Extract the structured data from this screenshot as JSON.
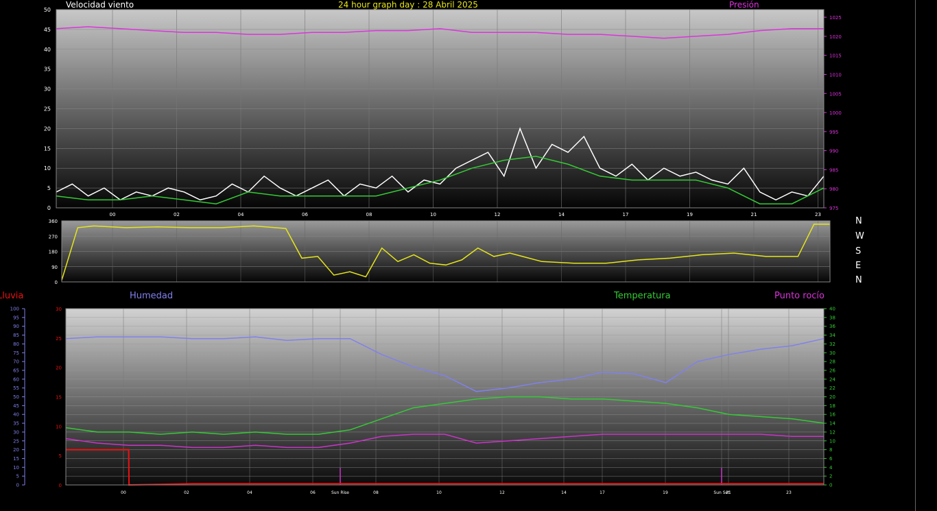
{
  "header": {
    "wind_title": "Velocidad viento",
    "date_title": "24 hour graph day : 28 Abril 2025",
    "pressure_title": "Presión"
  },
  "compass": [
    "N",
    "W",
    "S",
    "E",
    "N"
  ],
  "bottom_titles": {
    "rain": "Lluvia",
    "humidity": "Humedad",
    "temperature": "Temperatura",
    "dewpoint": "Punto rocío"
  },
  "markers": {
    "sunrise": "Sun Rise",
    "sunset": "Sun Set"
  },
  "colors": {
    "wind": "#ffffff",
    "wind_avg": "#33cc33",
    "pressure": "#dd33dd",
    "direction": "#e6e619",
    "humidity": "#8080ee",
    "temperature": "#33cc33",
    "dewpoint": "#cc33cc",
    "rain": "#ee1111",
    "pressure_axis": "#dd33dd",
    "temp_axis": "#33cc33",
    "humidity_axis": "#8080ee",
    "rain_axis": "#ee1111"
  },
  "chart_data": [
    {
      "type": "line",
      "name": "wind",
      "x_ticks": [
        "00",
        "02",
        "04",
        "06",
        "08",
        "10",
        "12",
        "14",
        "17",
        "19",
        "21",
        "23"
      ],
      "y_left_ticks": [
        0,
        5,
        10,
        15,
        20,
        25,
        30,
        35,
        40,
        45,
        50
      ],
      "y_right_ticks": [
        975,
        980,
        985,
        990,
        995,
        1000,
        1005,
        1010,
        1015,
        1020,
        1025
      ],
      "ylim_left": [
        0,
        50
      ],
      "ylim_right": [
        975,
        1027
      ],
      "series": [
        {
          "key": "gust",
          "axis": "left",
          "x": [
            0,
            0.5,
            1,
            1.5,
            2,
            2.5,
            3,
            3.5,
            4,
            4.5,
            5,
            5.5,
            6,
            6.5,
            7,
            7.5,
            8,
            8.5,
            9,
            9.5,
            10,
            10.5,
            11,
            11.5,
            12,
            12.5,
            13,
            13.5,
            14,
            14.5,
            15,
            15.5,
            16,
            16.5,
            17,
            17.5,
            18,
            18.5,
            19,
            19.5,
            20,
            20.5,
            21,
            21.5,
            22,
            22.5,
            23,
            23.5,
            24
          ],
          "values": [
            4,
            6,
            3,
            5,
            2,
            4,
            3,
            5,
            4,
            2,
            3,
            6,
            4,
            8,
            5,
            3,
            5,
            7,
            3,
            6,
            5,
            8,
            4,
            7,
            6,
            10,
            12,
            14,
            8,
            20,
            10,
            16,
            14,
            18,
            10,
            8,
            11,
            7,
            10,
            8,
            9,
            7,
            6,
            10,
            4,
            2,
            4,
            3,
            8
          ]
        },
        {
          "key": "average",
          "axis": "left",
          "x": [
            0,
            1,
            2,
            3,
            4,
            5,
            6,
            7,
            8,
            9,
            10,
            11,
            12,
            13,
            14,
            15,
            16,
            17,
            18,
            19,
            20,
            21,
            22,
            23,
            24
          ],
          "values": [
            3,
            2,
            2,
            3,
            2,
            1,
            4,
            3,
            3,
            3,
            3,
            5,
            7,
            10,
            12,
            13,
            11,
            8,
            7,
            7,
            7,
            5,
            1,
            1,
            5
          ]
        },
        {
          "key": "pressure",
          "axis": "right",
          "x": [
            0,
            1,
            2,
            3,
            4,
            5,
            6,
            7,
            8,
            9,
            10,
            11,
            12,
            13,
            14,
            15,
            16,
            17,
            18,
            19,
            20,
            21,
            22,
            23,
            24
          ],
          "values": [
            1022,
            1022.5,
            1022,
            1021.5,
            1021,
            1021,
            1020.5,
            1020.5,
            1021,
            1021,
            1021.5,
            1021.5,
            1022,
            1021,
            1021,
            1021,
            1020.5,
            1020.5,
            1020,
            1019.5,
            1020,
            1020.5,
            1021.5,
            1022,
            1022
          ]
        }
      ]
    },
    {
      "type": "line",
      "name": "wind-direction",
      "x_ticks": [
        "00",
        "02",
        "04",
        "06",
        "08",
        "10",
        "12",
        "14",
        "17",
        "19",
        "21",
        "23"
      ],
      "y_ticks": [
        0,
        90,
        180,
        270,
        360
      ],
      "ylim": [
        0,
        360
      ],
      "series": [
        {
          "key": "direction",
          "x": [
            0,
            0.5,
            1,
            2,
            3,
            4,
            5,
            6,
            7,
            7.5,
            8,
            8.5,
            9,
            9.5,
            10,
            10.5,
            11,
            11.5,
            12,
            12.5,
            13,
            13.5,
            14,
            15,
            16,
            17,
            18,
            19,
            20,
            21,
            22,
            23,
            23.5,
            24
          ],
          "values": [
            10,
            320,
            330,
            320,
            325,
            320,
            320,
            330,
            315,
            140,
            150,
            40,
            60,
            30,
            200,
            120,
            160,
            110,
            100,
            130,
            200,
            150,
            170,
            120,
            110,
            110,
            130,
            140,
            160,
            170,
            150,
            150,
            340,
            340
          ]
        }
      ]
    },
    {
      "type": "line",
      "name": "humidity-temperature",
      "x_ticks": [
        "00",
        "02",
        "04",
        "06",
        "Sun Rise",
        "08",
        "10",
        "12",
        "14",
        "17",
        "19",
        "Sun Set",
        "21",
        "23"
      ],
      "y_rain_ticks": [
        0,
        5,
        10,
        15,
        20,
        25,
        30
      ],
      "y_humidity_ticks": [
        0,
        5,
        10,
        15,
        20,
        25,
        30,
        35,
        40,
        45,
        50,
        55,
        60,
        65,
        70,
        75,
        80,
        85,
        90,
        95,
        100
      ],
      "y_temp_ticks": [
        0,
        2,
        4,
        6,
        8,
        10,
        12,
        14,
        16,
        18,
        20,
        22,
        24,
        26,
        28,
        30,
        32,
        34,
        36,
        38,
        40
      ],
      "ylim_rain": [
        0,
        30
      ],
      "ylim_humidity": [
        0,
        100
      ],
      "ylim_temp": [
        0,
        40
      ],
      "series": [
        {
          "key": "humidity",
          "axis": "humidity",
          "x": [
            0,
            1,
            2,
            3,
            4,
            5,
            6,
            7,
            8,
            9,
            10,
            11,
            12,
            13,
            14,
            15,
            16,
            17,
            18,
            19,
            20,
            21,
            22,
            23,
            24
          ],
          "values": [
            83,
            84,
            84,
            84,
            83,
            83,
            84,
            82,
            83,
            83,
            74,
            67,
            62,
            53,
            55,
            58,
            60,
            64,
            63,
            58,
            70,
            74,
            77,
            79,
            83
          ]
        },
        {
          "key": "temperature",
          "axis": "temp",
          "x": [
            0,
            1,
            2,
            3,
            4,
            5,
            6,
            7,
            8,
            9,
            10,
            11,
            12,
            13,
            14,
            15,
            16,
            17,
            18,
            19,
            20,
            21,
            22,
            23,
            24
          ],
          "values": [
            13,
            12,
            12,
            11.5,
            12,
            11.5,
            12,
            11.5,
            11.5,
            12.5,
            15,
            17.5,
            18.5,
            19.5,
            20,
            20,
            19.5,
            19.5,
            19,
            18.5,
            17.5,
            16,
            15.5,
            15,
            14
          ]
        },
        {
          "key": "dewpoint",
          "axis": "temp",
          "x": [
            0,
            1,
            2,
            3,
            4,
            5,
            6,
            7,
            8,
            9,
            10,
            11,
            12,
            13,
            14,
            15,
            16,
            17,
            18,
            19,
            20,
            21,
            22,
            23,
            24
          ],
          "values": [
            10.5,
            9.5,
            9,
            9,
            8.5,
            8.5,
            9,
            8.5,
            8.5,
            9.5,
            11,
            11.5,
            11.5,
            9.5,
            10,
            10.5,
            11,
            11.5,
            11.5,
            11.5,
            11.5,
            11.5,
            11.5,
            11,
            11
          ]
        },
        {
          "key": "rain",
          "axis": "rain",
          "x": [
            0,
            1,
            1.99,
            2,
            4,
            24
          ],
          "values": [
            6,
            6,
            6,
            0,
            0.2,
            0.2
          ]
        }
      ]
    }
  ]
}
